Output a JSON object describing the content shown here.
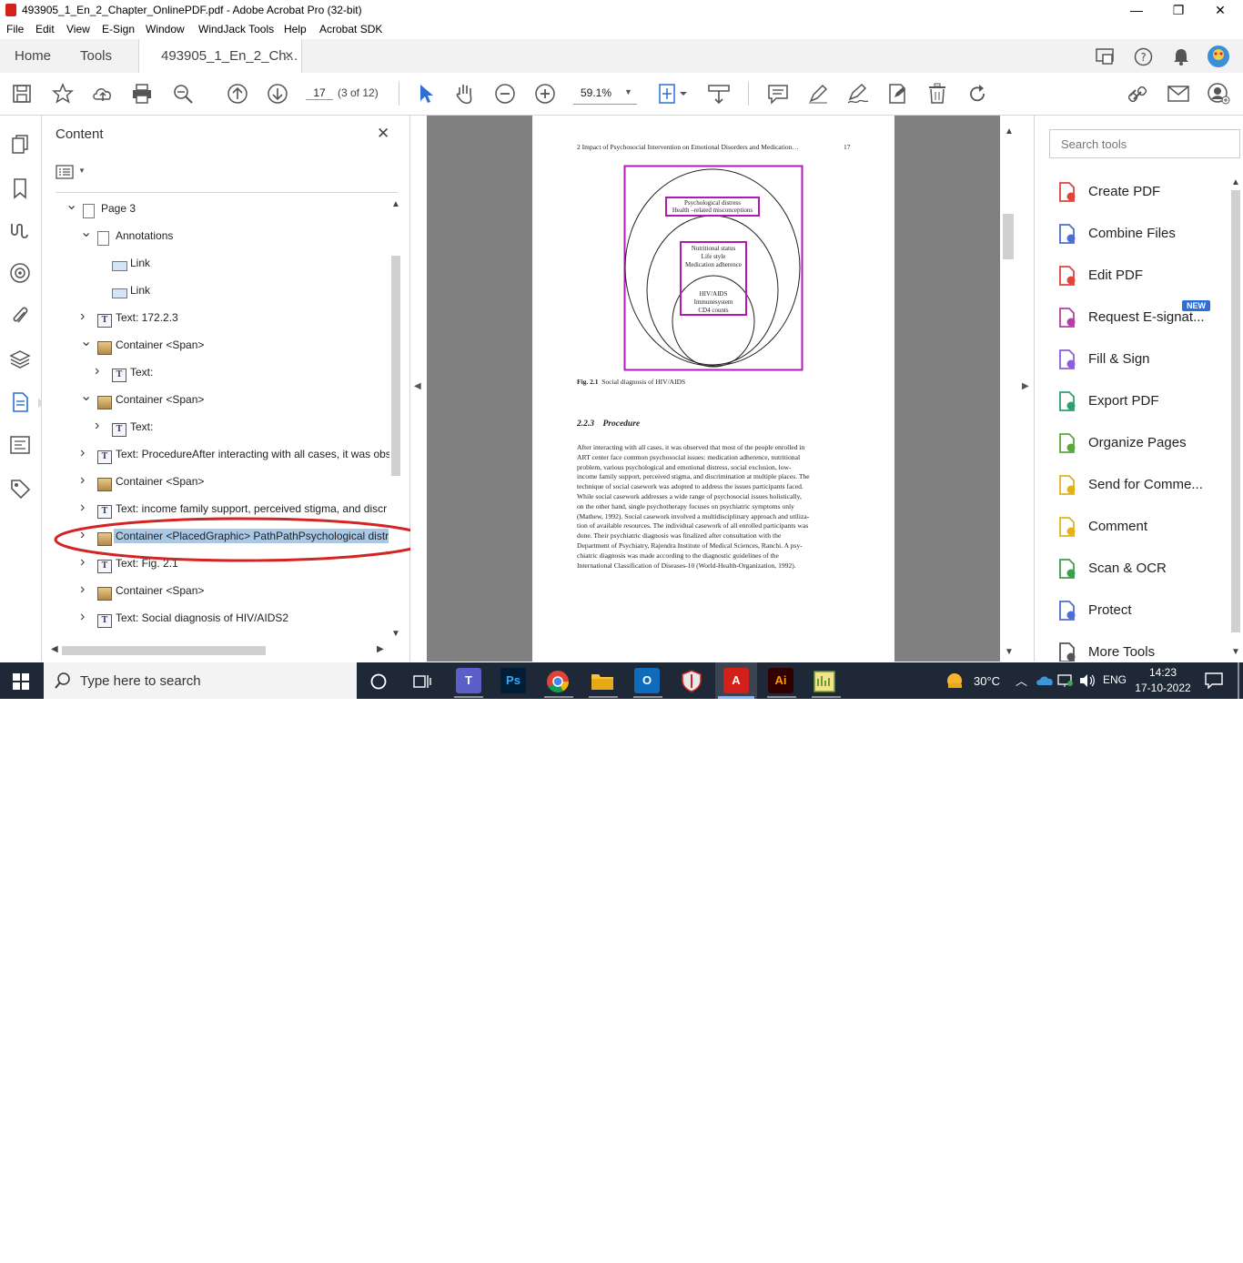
{
  "window": {
    "title": "493905_1_En_2_Chapter_OnlinePDF.pdf - Adobe Acrobat Pro (32-bit)",
    "minimize": "—",
    "restore": "❐",
    "close": "✕"
  },
  "menu": [
    "File",
    "Edit",
    "View",
    "E-Sign",
    "Window",
    "WindJack Tools",
    "Help",
    "Acrobat SDK"
  ],
  "tabs": {
    "home": "Home",
    "tools": "Tools",
    "doc": "493905_1_En_2_Ch...",
    "doc_close": "×"
  },
  "toolbar": {
    "page_number": "17",
    "page_of": "(3 of 12)",
    "zoom": "59.1%"
  },
  "content_panel": {
    "title": "Content",
    "close": "✕",
    "tree": [
      {
        "chevron": "down",
        "icon": "page",
        "label": "Page 3"
      },
      {
        "chevron": "down",
        "icon": "page",
        "label": "Annotations"
      },
      {
        "chevron": "",
        "icon": "link",
        "label": "Link"
      },
      {
        "chevron": "",
        "icon": "link",
        "label": "Link"
      },
      {
        "chevron": "right",
        "icon": "text",
        "label": "Text: 172.2.3"
      },
      {
        "chevron": "down",
        "icon": "container",
        "label": "Container <Span>"
      },
      {
        "chevron": "right",
        "icon": "text",
        "label": "Text:"
      },
      {
        "chevron": "down",
        "icon": "container",
        "label": "Container <Span>"
      },
      {
        "chevron": "right",
        "icon": "text",
        "label": "Text:"
      },
      {
        "chevron": "right",
        "icon": "text",
        "label": "Text: ProcedureAfter interacting with all cases, it was obs"
      },
      {
        "chevron": "right",
        "icon": "container",
        "label": "Container <Span>"
      },
      {
        "chevron": "right",
        "icon": "text",
        "label": "Text: income family support, perceived stigma, and discr"
      },
      {
        "chevron": "right",
        "icon": "container",
        "label": "Container <PlacedGraphic> PathPathPsychological distr"
      },
      {
        "chevron": "right",
        "icon": "text",
        "label": "Text: Fig. 2.1"
      },
      {
        "chevron": "right",
        "icon": "container",
        "label": "Container <Span>"
      },
      {
        "chevron": "right",
        "icon": "text",
        "label": "Text: Social diagnosis of HIV/AIDS2"
      }
    ]
  },
  "document": {
    "running_head": "2   Impact of Psychosocial Intervention on Emotional Disorders and Medication…",
    "page_num": "17",
    "diagram": {
      "box1": [
        "Psychological distress",
        "Health –related misconceptions"
      ],
      "box2": [
        "Nutritional status",
        "Life style",
        "Medication adherence"
      ],
      "box3": [
        "HIV/AIDS",
        "Immunesystem",
        "CD4 counts"
      ]
    },
    "fig_label": "Fig. 2.1",
    "fig_caption": "Social diagnosis of HIV/AIDS",
    "section_num": "2.2.3",
    "section_title": "Procedure",
    "body_lines": [
      "After interacting with all cases, it was observed that most of the people enrolled in",
      "ART center face common psychosocial issues: medication adherence, nutritional",
      "problem, various psychological and emotional distress, social exclusion, low-",
      "income family support, perceived stigma, and discrimination at multiple places. The",
      "technique of social casework was adopted to address the issues participants faced.",
      "While social casework addresses a wide range of psychosocial issues holistically,",
      "on the other hand, single psychotherapy focuses on psychiatric symptoms only",
      "(Mathew, 1992). Social casework involved a multidisciplinary approach and utiliza-",
      "tion of available resources. The individual casework of all enrolled participants was",
      "done. Their psychiatric diagnosis was finalized after consultation with the",
      "Department of Psychiatry, Rajendra Institute of Medical Sciences, Ranchi. A psy-",
      "chiatric diagnosis was made according to the diagnostic guidelines of the",
      "International Classification of Diseases-10 (World-Health-Organization, 1992)."
    ]
  },
  "right_panel": {
    "search_placeholder": "Search tools",
    "new_badge": "NEW",
    "tools": [
      {
        "label": "Create PDF",
        "color": "#e0443a"
      },
      {
        "label": "Combine Files",
        "color": "#4f6bd6"
      },
      {
        "label": "Edit PDF",
        "color": "#e0443a"
      },
      {
        "label": "Request E-signat...",
        "color": "#b43ea6"
      },
      {
        "label": "Fill & Sign",
        "color": "#8b5fd9"
      },
      {
        "label": "Export PDF",
        "color": "#2f9e6f"
      },
      {
        "label": "Organize Pages",
        "color": "#5aa83a"
      },
      {
        "label": "Send for Comme...",
        "color": "#e3b21b"
      },
      {
        "label": "Comment",
        "color": "#e3b21b"
      },
      {
        "label": "Scan & OCR",
        "color": "#3a9e4f"
      },
      {
        "label": "Protect",
        "color": "#4f6bd6"
      },
      {
        "label": "More Tools",
        "color": "#555555"
      }
    ]
  },
  "taskbar": {
    "search_placeholder": "Type here to search",
    "weather": "30°C",
    "language": "ENG",
    "time": "14:23",
    "date": "17-10-2022"
  },
  "colors": {
    "highlight_oval": "#d42323",
    "diagram_box": "#b418b4",
    "selection": "#a9c8e6"
  }
}
